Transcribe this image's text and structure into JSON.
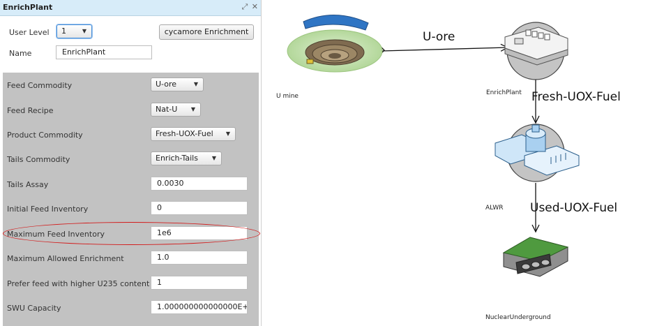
{
  "window": {
    "title": "EnrichPlant",
    "expand_glyph": "⤢",
    "close_glyph": "✕"
  },
  "header": {
    "user_level_label": "User Level",
    "user_level_value": "1",
    "archetype_button": "cycamore Enrichment",
    "name_label": "Name",
    "name_value": "EnrichPlant"
  },
  "fields": [
    {
      "label": "Feed Commodity",
      "kind": "dropdown",
      "value": "U-ore"
    },
    {
      "label": "Feed Recipe",
      "kind": "dropdown",
      "value": "Nat-U"
    },
    {
      "label": "Product Commodity",
      "kind": "dropdown",
      "value": "Fresh-UOX-Fuel"
    },
    {
      "label": "Tails Commodity",
      "kind": "dropdown",
      "value": "Enrich-Tails"
    },
    {
      "label": "Tails Assay",
      "kind": "text",
      "value": "0.0030"
    },
    {
      "label": "Initial Feed Inventory",
      "kind": "text",
      "value": "0"
    },
    {
      "label": "Maximum Feed Inventory",
      "kind": "text",
      "value": "1e6"
    },
    {
      "label": "Maximum Allowed Enrichment",
      "kind": "text",
      "value": "1.0"
    },
    {
      "label": "Prefer feed with higher U235 content",
      "kind": "text",
      "value": "1"
    },
    {
      "label": "SWU Capacity",
      "kind": "text",
      "value": "1.000000000000000E+"
    }
  ],
  "diagram": {
    "nodes": [
      {
        "id": "umine",
        "label": "U mine",
        "icon": "mine-icon"
      },
      {
        "id": "enrich",
        "label": "EnrichPlant",
        "icon": "enrichment-plant-icon"
      },
      {
        "id": "alwr",
        "label": "ALWR",
        "icon": "reactor-icon"
      },
      {
        "id": "repo",
        "label": "NuclearUnderground",
        "icon": "repository-icon"
      }
    ],
    "edges": [
      {
        "from": "umine",
        "to": "enrich",
        "label": "U-ore"
      },
      {
        "from": "enrich",
        "to": "alwr",
        "label": "Fresh-UOX-Fuel"
      },
      {
        "from": "alwr",
        "to": "repo",
        "label": "Used-UOX-Fuel"
      }
    ]
  },
  "colors": {
    "highlight": "#d31a1a",
    "titlebar": "#d7ecf9",
    "panel_gray": "#c2c2c2"
  }
}
